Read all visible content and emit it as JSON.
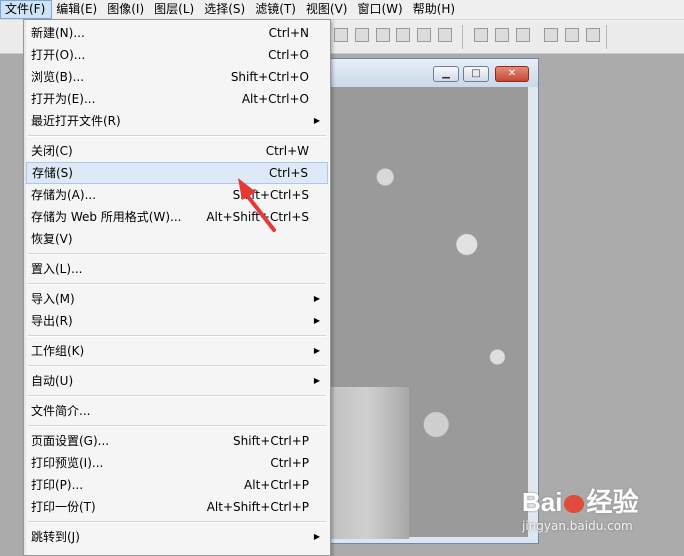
{
  "menubar": [
    {
      "label": "文件(F)",
      "active": true
    },
    {
      "label": "编辑(E)"
    },
    {
      "label": "图像(I)"
    },
    {
      "label": "图层(L)"
    },
    {
      "label": "选择(S)"
    },
    {
      "label": "滤镜(T)"
    },
    {
      "label": "视图(V)"
    },
    {
      "label": "窗口(W)"
    },
    {
      "label": "帮助(H)"
    }
  ],
  "file_menu": {
    "items": [
      {
        "label": "新建(N)...",
        "shortcut": "Ctrl+N"
      },
      {
        "label": "打开(O)...",
        "shortcut": "Ctrl+O"
      },
      {
        "label": "浏览(B)...",
        "shortcut": "Shift+Ctrl+O"
      },
      {
        "label": "打开为(E)...",
        "shortcut": "Alt+Ctrl+O"
      },
      {
        "label": "最近打开文件(R)",
        "submenu": true
      },
      {
        "separator": true
      },
      {
        "label": "关闭(C)",
        "shortcut": "Ctrl+W"
      },
      {
        "label": "存储(S)",
        "shortcut": "Ctrl+S",
        "highlighted": true
      },
      {
        "label": "存储为(A)...",
        "shortcut": "Shift+Ctrl+S"
      },
      {
        "label": "存储为 Web 所用格式(W)...",
        "shortcut": "Alt+Shift+Ctrl+S"
      },
      {
        "label": "恢复(V)"
      },
      {
        "separator": true
      },
      {
        "label": "置入(L)..."
      },
      {
        "separator": true
      },
      {
        "label": "导入(M)",
        "submenu": true
      },
      {
        "label": "导出(R)",
        "submenu": true
      },
      {
        "separator": true
      },
      {
        "label": "工作组(K)",
        "submenu": true
      },
      {
        "separator": true
      },
      {
        "label": "自动(U)",
        "submenu": true
      },
      {
        "separator": true
      },
      {
        "label": "文件简介..."
      },
      {
        "separator": true
      },
      {
        "label": "页面设置(G)...",
        "shortcut": "Shift+Ctrl+P"
      },
      {
        "label": "打印预览(I)...",
        "shortcut": "Ctrl+P"
      },
      {
        "label": "打印(P)...",
        "shortcut": "Alt+Ctrl+P"
      },
      {
        "label": "打印一份(T)",
        "shortcut": "Alt+Shift+Ctrl+P"
      },
      {
        "separator": true
      },
      {
        "label": "跳转到(J)",
        "submenu": true
      }
    ]
  },
  "doc_window": {
    "minimize_glyph": "▁",
    "maximize_glyph": "□",
    "close_glyph": "✕"
  },
  "watermark": {
    "logo_left": "Bai",
    "logo_right": "经验",
    "url": "jingyan.baidu.com"
  },
  "colors": {
    "accent": "#e53935",
    "highlight": "#dde9f6"
  },
  "icons": {
    "submenu": "triangle-right-icon",
    "annotation": "red-arrow-icon"
  }
}
